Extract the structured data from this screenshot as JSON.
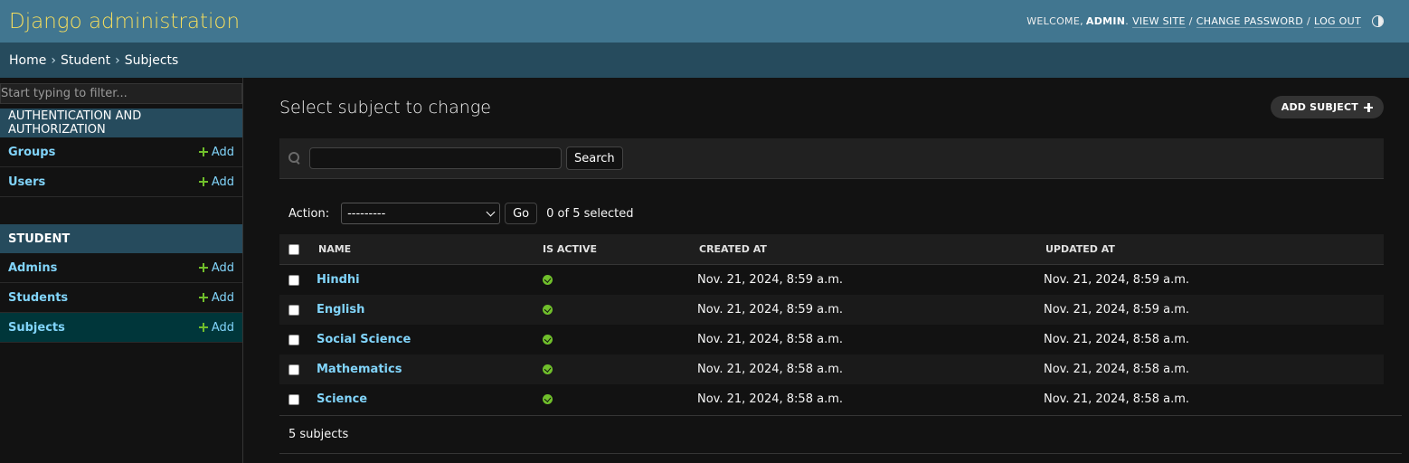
{
  "header": {
    "branding": "Django administration",
    "welcome": "WELCOME,",
    "username": "ADMIN",
    "period": ".",
    "view_site": "VIEW SITE",
    "change_password": "CHANGE PASSWORD",
    "log_out": "LOG OUT",
    "slash": "/"
  },
  "breadcrumbs": {
    "home": "Home",
    "app": "Student",
    "current": "Subjects",
    "separator": "›"
  },
  "sidebar": {
    "filter_placeholder": "Start typing to filter...",
    "modules": [
      {
        "caption": "Authentication and Authorization",
        "models": [
          {
            "name": "Groups",
            "add": "Add"
          },
          {
            "name": "Users",
            "add": "Add"
          }
        ]
      },
      {
        "caption": "Student",
        "models": [
          {
            "name": "Admins",
            "add": "Add"
          },
          {
            "name": "Students",
            "add": "Add"
          },
          {
            "name": "Subjects",
            "add": "Add"
          }
        ]
      }
    ]
  },
  "content": {
    "title": "Select subject to change",
    "add_button": "ADD SUBJECT",
    "search_button": "Search",
    "search_value": "",
    "action_label": "Action:",
    "action_selected": "---------",
    "go_button": "Go",
    "selected_count": "0 of 5 selected",
    "columns": [
      "NAME",
      "IS ACTIVE",
      "CREATED AT",
      "UPDATED AT"
    ],
    "rows": [
      {
        "name": "Hindhi",
        "is_active": true,
        "created_at": "Nov. 21, 2024, 8:59 a.m.",
        "updated_at": "Nov. 21, 2024, 8:59 a.m."
      },
      {
        "name": "English",
        "is_active": true,
        "created_at": "Nov. 21, 2024, 8:59 a.m.",
        "updated_at": "Nov. 21, 2024, 8:59 a.m."
      },
      {
        "name": "Social Science",
        "is_active": true,
        "created_at": "Nov. 21, 2024, 8:58 a.m.",
        "updated_at": "Nov. 21, 2024, 8:58 a.m."
      },
      {
        "name": "Mathematics",
        "is_active": true,
        "created_at": "Nov. 21, 2024, 8:58 a.m.",
        "updated_at": "Nov. 21, 2024, 8:58 a.m."
      },
      {
        "name": "Science",
        "is_active": true,
        "created_at": "Nov. 21, 2024, 8:58 a.m.",
        "updated_at": "Nov. 21, 2024, 8:58 a.m."
      }
    ],
    "result_count": "5 subjects"
  },
  "colors": {
    "header_bg": "#417690",
    "breadcrumb_bg": "#264b5d",
    "brand_text": "#f5dd5d",
    "link": "#81d4fa",
    "add_green": "#70bf2b",
    "page_bg": "#121212"
  },
  "icons": {
    "theme_toggle": "half-circle-icon",
    "add": "plus-icon",
    "search": "search-icon",
    "active": "check-circle-icon"
  }
}
